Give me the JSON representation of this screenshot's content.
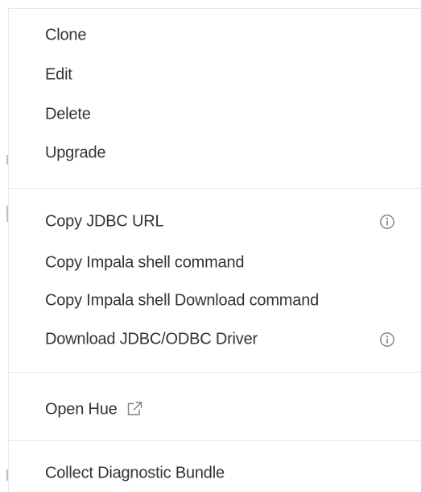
{
  "menu": {
    "group1": [
      {
        "label": "Clone"
      },
      {
        "label": "Edit"
      },
      {
        "label": "Delete"
      },
      {
        "label": "Upgrade"
      }
    ],
    "group2": [
      {
        "label": "Copy JDBC URL",
        "icon": "info-icon"
      },
      {
        "label": "Copy Impala shell command"
      },
      {
        "label": "Copy Impala shell Download command"
      },
      {
        "label": "Download JDBC/ODBC Driver",
        "icon": "info-icon"
      }
    ],
    "group3": [
      {
        "label": "Open Hue",
        "icon": "external-link-icon"
      }
    ],
    "group4": [
      {
        "label": "Collect Diagnostic Bundle"
      }
    ]
  },
  "colors": {
    "text": "#2f3439",
    "divider": "#e5e7ea",
    "icon": "#7a8087"
  }
}
